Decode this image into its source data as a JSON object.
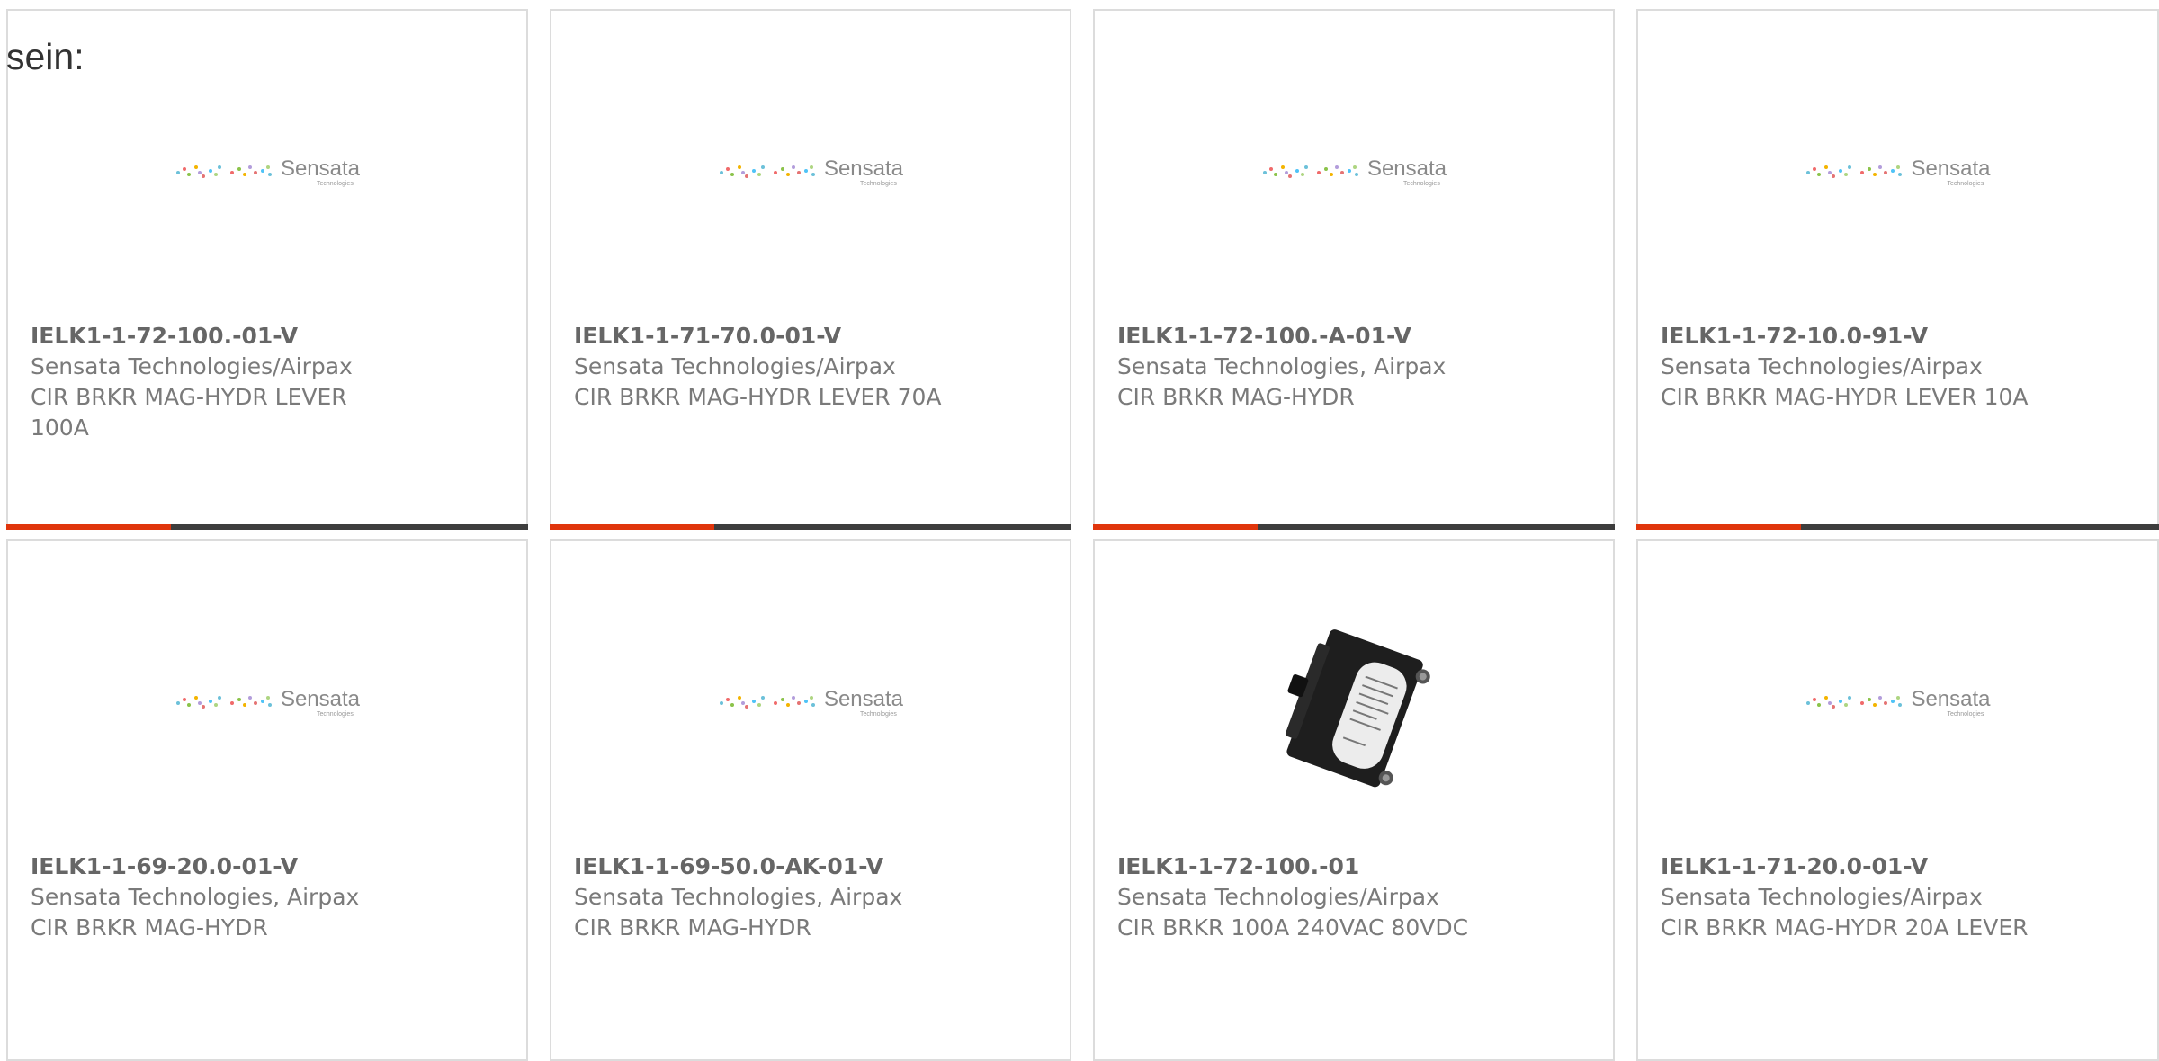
{
  "intro_text": "sein:",
  "colors": {
    "accent": "#e0350c",
    "bar": "#3d3d3d",
    "border": "#dcdcdc"
  },
  "logo": {
    "name": "Sensata",
    "sub": "Technologies"
  },
  "products": [
    {
      "pn": "IELK1-1-72-100.-01-V",
      "mfr": "Sensata Technologies/Airpax",
      "desc": "CIR BRKR MAG-HYDR LEVER 100A",
      "image": "sensata-logo"
    },
    {
      "pn": "IELK1-1-71-70.0-01-V",
      "mfr": "Sensata Technologies/Airpax",
      "desc": "CIR BRKR MAG-HYDR LEVER 70A",
      "image": "sensata-logo"
    },
    {
      "pn": "IELK1-1-72-100.-A-01-V",
      "mfr": "Sensata Technologies, Airpax",
      "desc": "CIR BRKR MAG-HYDR",
      "image": "sensata-logo"
    },
    {
      "pn": "IELK1-1-72-10.0-91-V",
      "mfr": "Sensata Technologies/Airpax",
      "desc": "CIR BRKR MAG-HYDR LEVER 10A",
      "image": "sensata-logo"
    },
    {
      "pn": "IELK1-1-69-20.0-01-V",
      "mfr": "Sensata Technologies, Airpax",
      "desc": "CIR BRKR MAG-HYDR",
      "image": "sensata-logo"
    },
    {
      "pn": "IELK1-1-69-50.0-AK-01-V",
      "mfr": "Sensata Technologies, Airpax",
      "desc": "CIR BRKR MAG-HYDR",
      "image": "sensata-logo"
    },
    {
      "pn": "IELK1-1-72-100.-01",
      "mfr": "Sensata Technologies/Airpax",
      "desc": "CIR BRKR 100A 240VAC 80VDC",
      "image": "circuit-breaker-photo"
    },
    {
      "pn": "IELK1-1-71-20.0-01-V",
      "mfr": "Sensata Technologies/Airpax",
      "desc": "CIR BRKR MAG-HYDR 20A LEVER",
      "image": "sensata-logo"
    }
  ]
}
